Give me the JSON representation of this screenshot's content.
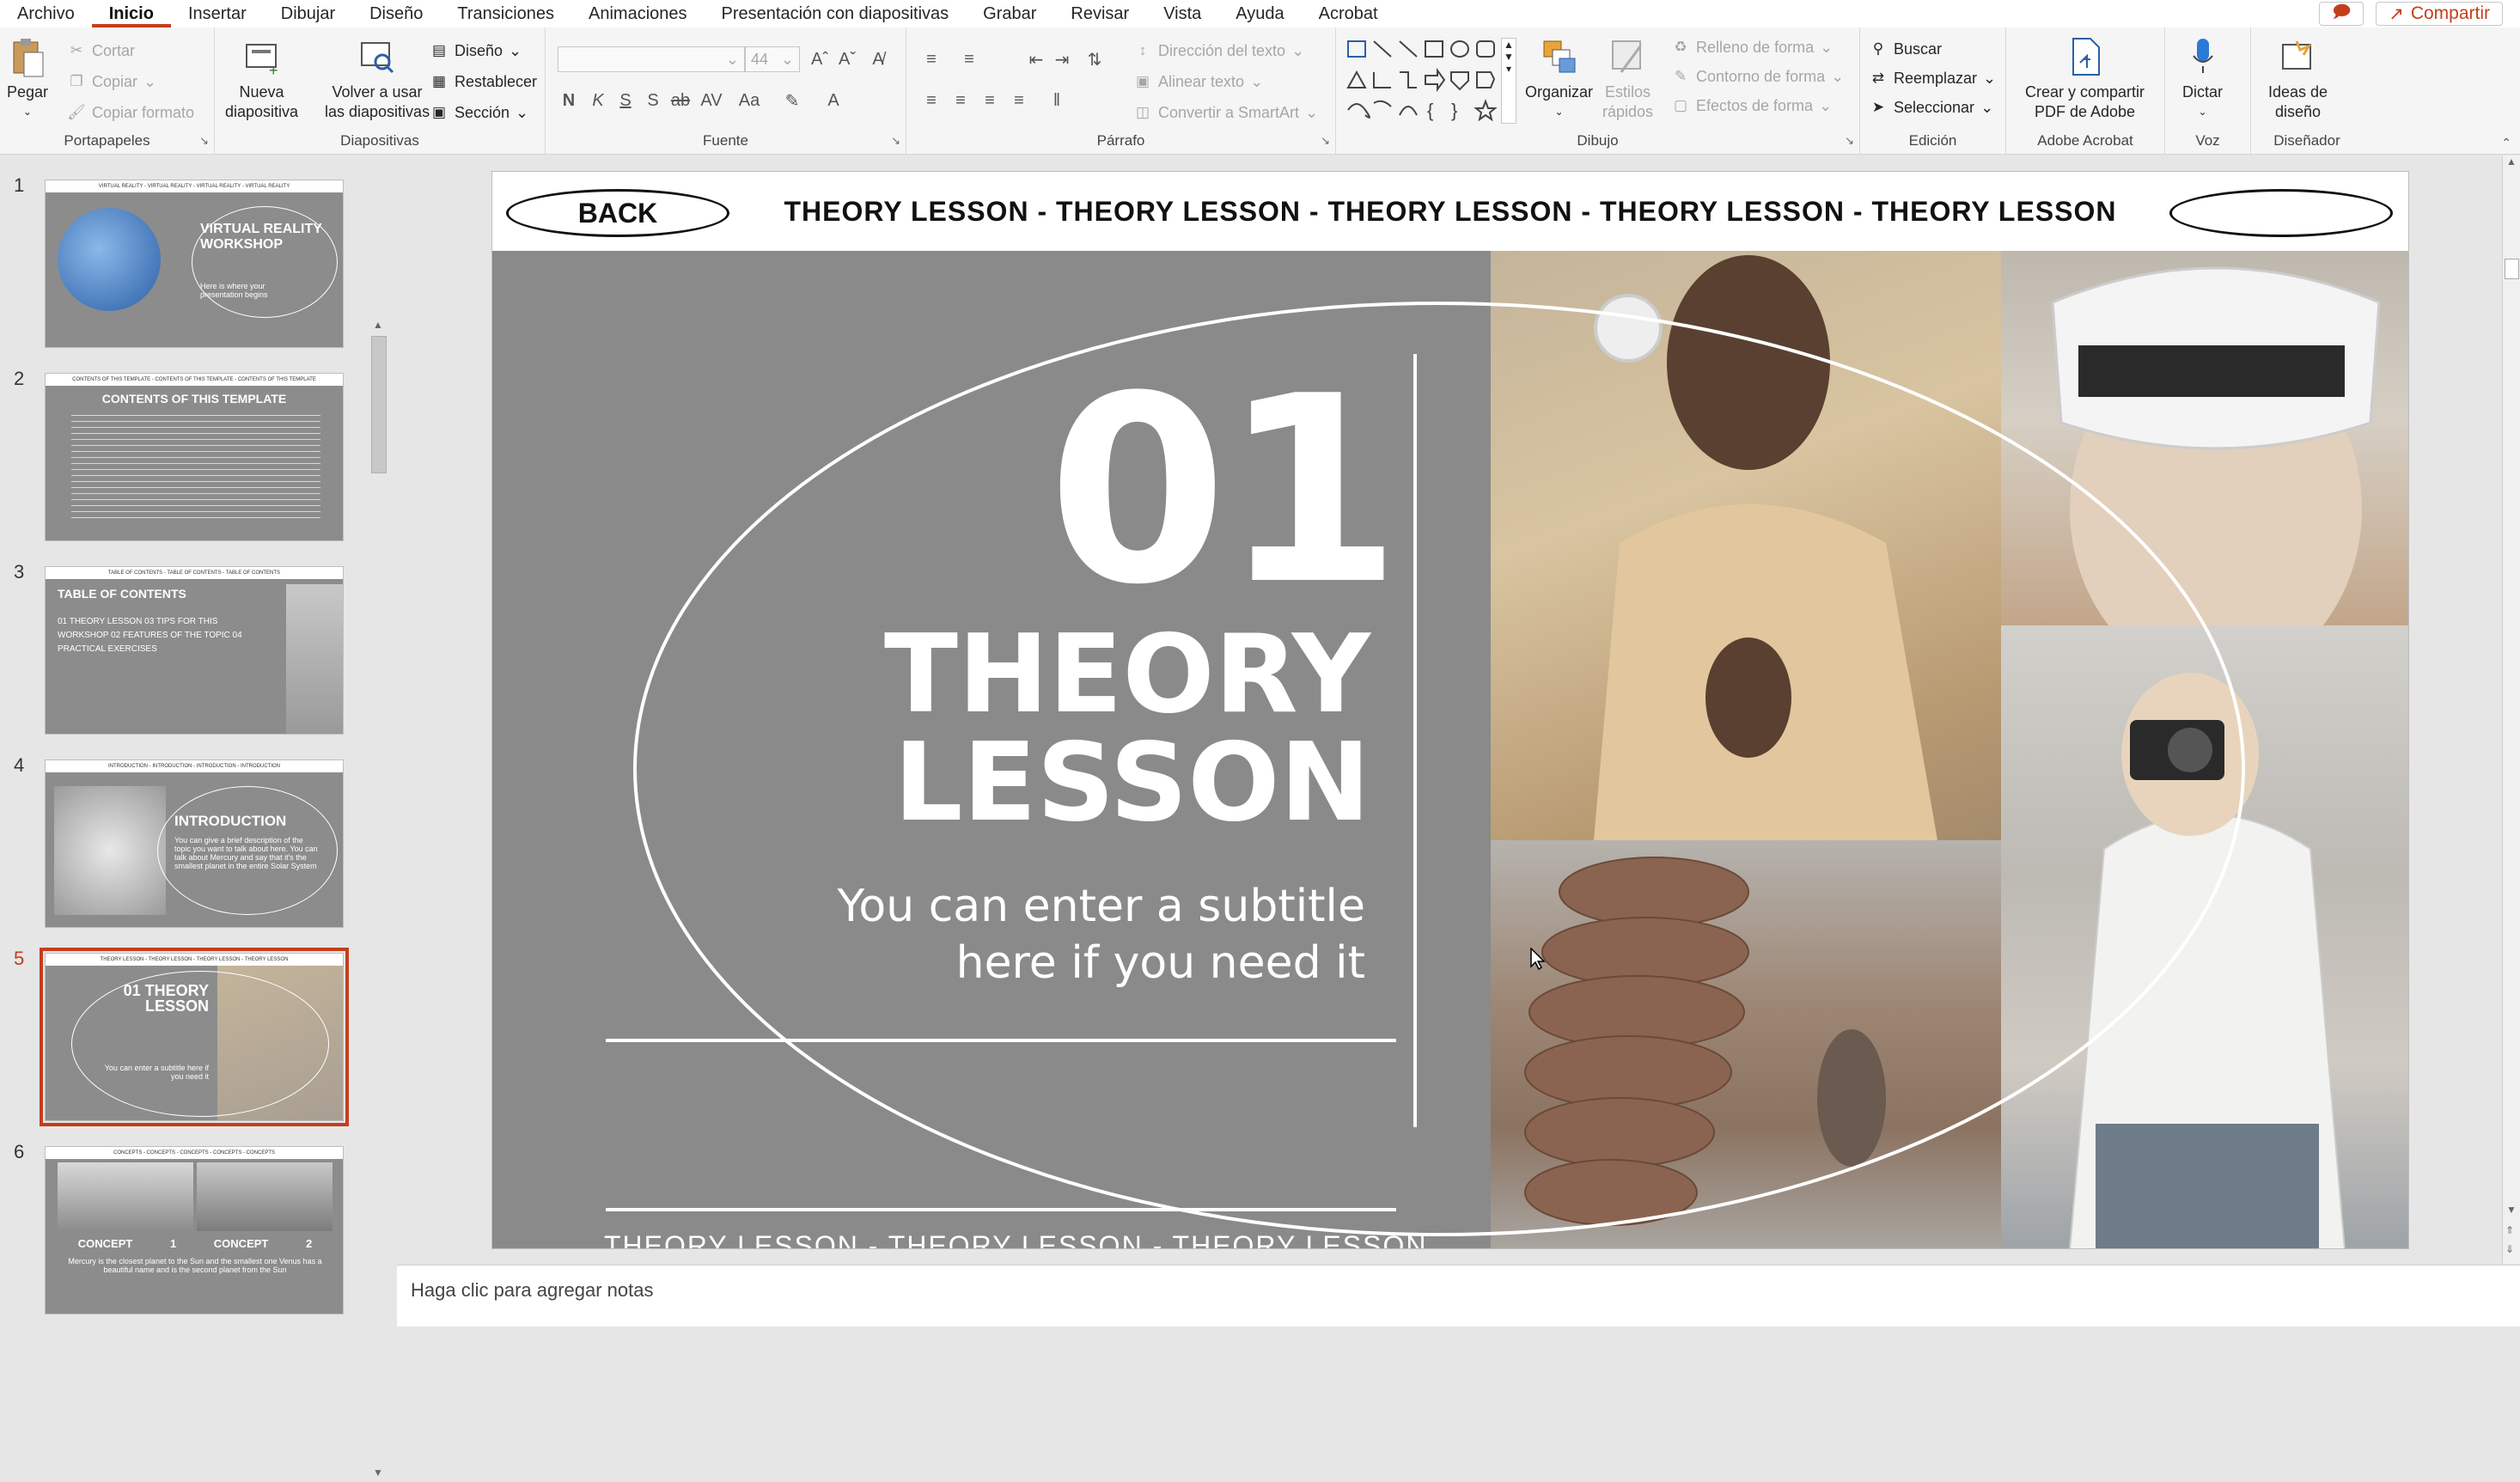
{
  "tabs": [
    "Archivo",
    "Inicio",
    "Insertar",
    "Dibujar",
    "Diseño",
    "Transiciones",
    "Animaciones",
    "Presentación con diapositivas",
    "Grabar",
    "Revisar",
    "Vista",
    "Ayuda",
    "Acrobat"
  ],
  "share_label": "Compartir",
  "ribbon": {
    "portapapeles": {
      "label": "Portapapeles",
      "paste": "Pegar",
      "cut": "Cortar",
      "copy": "Copiar",
      "format_painter": "Copiar formato"
    },
    "diapositivas": {
      "label": "Diapositivas",
      "new_slide_1": "Nueva",
      "new_slide_2": "diapositiva",
      "reuse_1": "Volver a usar",
      "reuse_2": "las diapositivas",
      "layout": "Diseño",
      "reset": "Restablecer",
      "section": "Sección"
    },
    "fuente": {
      "label": "Fuente",
      "font_size": "44"
    },
    "parrafo": {
      "label": "Párrafo",
      "text_direction": "Dirección del texto",
      "align_text": "Alinear texto",
      "smartart": "Convertir a SmartArt"
    },
    "dibujo": {
      "label": "Dibujo",
      "arrange": "Organizar",
      "quick_styles_1": "Estilos",
      "quick_styles_2": "rápidos",
      "shape_fill": "Relleno de forma",
      "shape_outline": "Contorno de forma",
      "shape_effects": "Efectos de forma"
    },
    "edicion": {
      "label": "Edición",
      "find": "Buscar",
      "replace": "Reemplazar",
      "select": "Seleccionar"
    },
    "acrobat": {
      "label": "Adobe Acrobat",
      "create_1": "Crear y compartir",
      "create_2": "PDF de Adobe"
    },
    "voz": {
      "label": "Voz",
      "dictate": "Dictar"
    },
    "disenador": {
      "label": "Diseñador",
      "ideas_1": "Ideas de",
      "ideas_2": "diseño"
    }
  },
  "thumbnails": [
    {
      "num": "1",
      "top_text": "VIRTUAL REALITY - VIRTUAL REALITY - VIRTUAL REALITY - VIRTUAL REALITY",
      "title": "VIRTUAL REALITY WORKSHOP",
      "text": "Here is where your presentation begins"
    },
    {
      "num": "2",
      "top_text": "CONTENTS OF THIS TEMPLATE - CONTENTS OF THIS TEMPLATE - CONTENTS OF THIS TEMPLATE",
      "title": "CONTENTS OF THIS TEMPLATE",
      "text": ""
    },
    {
      "num": "3",
      "top_text": "TABLE OF CONTENTS - TABLE OF CONTENTS - TABLE OF CONTENTS",
      "title": "TABLE OF CONTENTS",
      "text": "01 THEORY LESSON   03 TIPS FOR THIS WORKSHOP   02 FEATURES OF THE TOPIC   04 PRACTICAL EXERCISES"
    },
    {
      "num": "4",
      "top_text": "INTRODUCTION - INTRODUCTION - INTRODUCTION - INTRODUCTION",
      "title": "INTRODUCTION",
      "text": "You can give a brief description of the topic you want to talk about here. You can talk about Mercury and say that it's the smallest planet in the entire Solar System"
    },
    {
      "num": "5",
      "top_text": "THEORY LESSON - THEORY LESSON - THEORY LESSON - THEORY LESSON",
      "title": "01 THEORY LESSON",
      "text": "You can enter a subtitle here if you need it"
    },
    {
      "num": "6",
      "top_text": "CONCEPTS - CONCEPTS - CONCEPTS - CONCEPTS - CONCEPTS",
      "title": "CONCEPT 1   CONCEPT 2",
      "text": "Mercury is the closest planet to the Sun and the smallest one   Venus has a beautiful name and is the second planet from the Sun"
    }
  ],
  "slide": {
    "back_label": "BACK",
    "header_marquee": "THEORY LESSON - THEORY LESSON - THEORY LESSON - THEORY LESSON - THEORY LESSON",
    "number": "01",
    "title_line1": "THEORY",
    "title_line2": "LESSON",
    "subtitle_line1": "You can enter a subtitle",
    "subtitle_line2": "here if you need it",
    "footer_marquee": "THEORY LESSON - THEORY LESSON - THEORY LESSON"
  },
  "notes_placeholder": "Haga clic para agregar notas",
  "colors": {
    "accent": "#c43e1c",
    "slide_bg": "#8a8a8a",
    "ribbon_bg": "#f5f5f5"
  }
}
